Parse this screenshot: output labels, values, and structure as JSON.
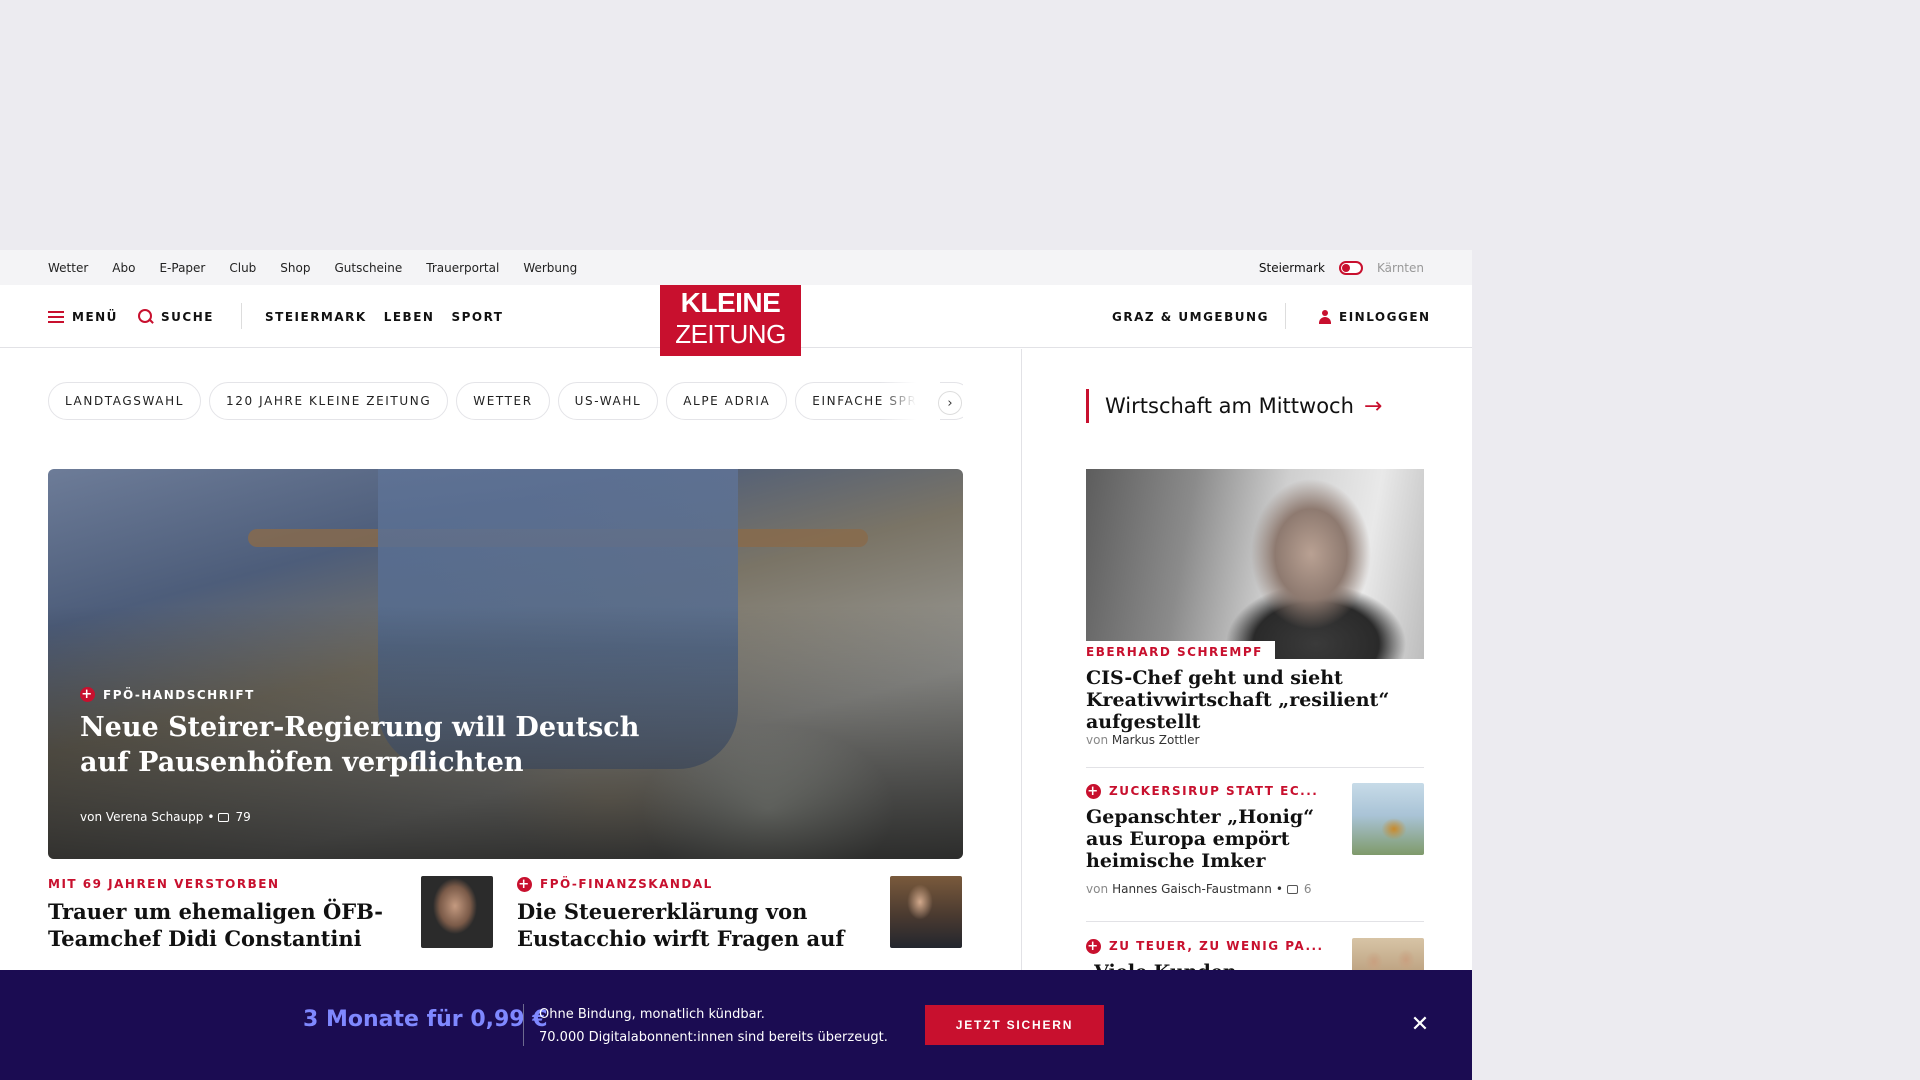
{
  "utility_bar": {
    "links": [
      "Wetter",
      "Abo",
      "E-Paper",
      "Club",
      "Shop",
      "Gutscheine",
      "Trauerportal",
      "Werbung"
    ],
    "region_active": "Steiermark",
    "region_inactive": "Kärnten"
  },
  "header": {
    "menu_label": "MENÜ",
    "search_label": "SUCHE",
    "nav": [
      "STEIERMARK",
      "LEBEN",
      "SPORT"
    ],
    "logo_line1": "KLEINE",
    "logo_line2": "ZEITUNG",
    "location_label": "GRAZ & UMGEBUNG",
    "login_label": "EINLOGGEN"
  },
  "chips": [
    "LANDTAGSWAHL",
    "120 JAHRE KLEINE ZEITUNG",
    "WETTER",
    "US-WAHL",
    "ALPE ADRIA",
    "EINFACHE SPRACHE"
  ],
  "hero": {
    "kicker": "FPÖ-HANDSCHRIFT",
    "title": "Neue Steirer-Regierung will Deutsch auf Pausenhöfen verpflichten",
    "byline": "von Verena Schaupp",
    "comments": "79"
  },
  "teasers": [
    {
      "kicker": "MIT 69 JAHREN VERSTORBEN",
      "title": "Trauer um ehemaligen ÖFB-Teamchef Didi Constantini",
      "plus": false
    },
    {
      "kicker": "FPÖ-FINANZSKANDAL",
      "title": "Die Steuererklärung von Eustacchio wirft Fragen auf",
      "plus": true
    }
  ],
  "sidebar": {
    "heading": "Wirtschaft am Mittwoch",
    "lead": {
      "kicker": "EBERHARD SCHREMPF",
      "title": "CIS-Chef geht und sieht Kreativwirtschaft „resilient“ aufgestellt",
      "byline_prefix": "von",
      "author": "Markus Zottler"
    },
    "items": [
      {
        "kicker": "ZUCKERSIRUP STATT EC...",
        "title": "Gepanschter „Honig“ aus Europa empört heimische Imker",
        "byline_prefix": "von",
        "author": "Hannes Gaisch-Faustmann",
        "comments": "6"
      },
      {
        "kicker": "ZU TEUER, ZU WENIG PA...",
        "title": "„Viele Kunden meiden"
      }
    ]
  },
  "promo": {
    "price": "3 Monate für 0,99 €",
    "line1": "Ohne Bindung, monatlich kündbar.",
    "line2": "70.000 Digitalabonnent:innen sind bereits überzeugt.",
    "cta": "JETZT SICHERN"
  },
  "colors": {
    "brand_red": "#c8102e",
    "promo_bg": "#1b0c52",
    "promo_price": "#7f88ff",
    "ad_space_bg": "#ecebf0"
  }
}
